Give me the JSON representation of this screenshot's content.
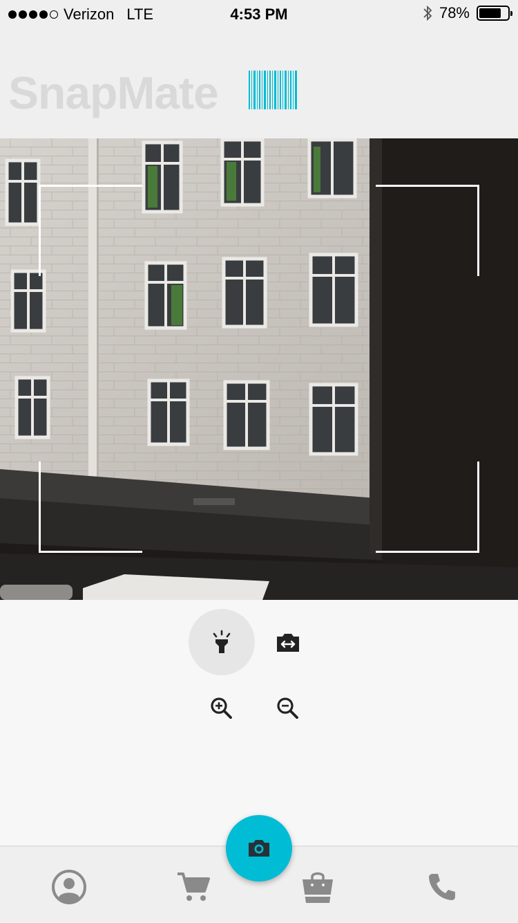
{
  "status_bar": {
    "carrier": "Verizon",
    "network": "LTE",
    "time": "4:53 PM",
    "battery": "78%",
    "battery_level": 0.78,
    "signal_bars_filled": 4,
    "signal_bars_total": 5,
    "bluetooth_icon": "bluetooth-icon"
  },
  "header": {
    "title": "SnapMate",
    "logo_icon": "barcode-icon",
    "accent": "#00bcd4"
  },
  "camera": {
    "view": "live camera preview",
    "frame_icon": "scan-frame-corners"
  },
  "controls": {
    "flash_icon": "flashlight-icon",
    "flip_icon": "switch-camera-icon",
    "zoom_in_icon": "zoom-in-icon",
    "zoom_out_icon": "zoom-out-icon",
    "active_control": "flash"
  },
  "bottom_nav": {
    "items": [
      {
        "icon": "account-icon"
      },
      {
        "icon": "cart-icon"
      },
      {
        "icon": "shopping-bag-icon"
      },
      {
        "icon": "phone-icon"
      }
    ],
    "fab_icon": "camera-icon",
    "fab_color": "#00bcd4",
    "icon_color": "#8a8a8a"
  }
}
